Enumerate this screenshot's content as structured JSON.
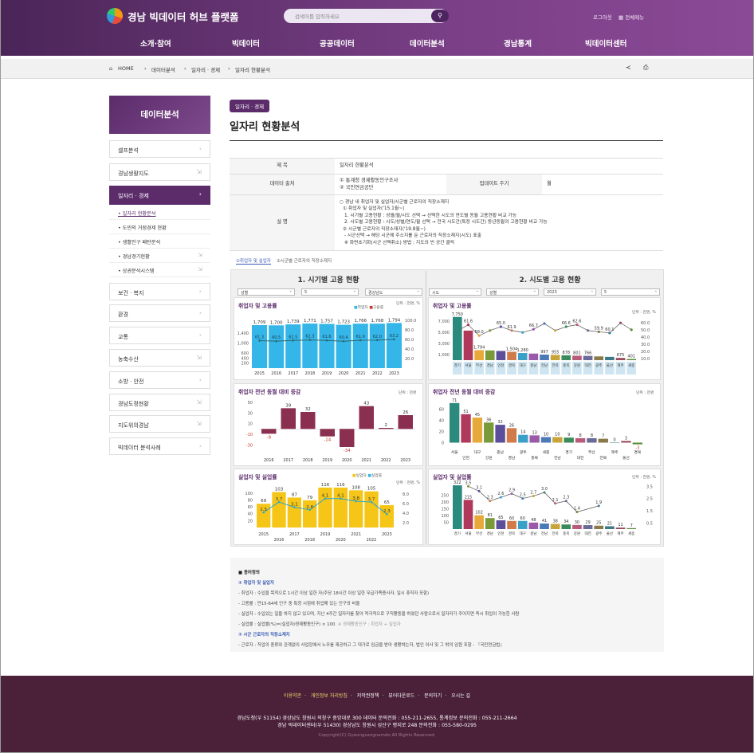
{
  "header": {
    "logo": "경남 빅데이터 허브 플랫폼",
    "search_placeholder": "검색어를 입력하세요",
    "login": "로그아웃",
    "all_menu": "전체메뉴"
  },
  "nav": [
    "소개·참여",
    "빅데이터",
    "공공데이터",
    "데이터분석",
    "경남통계",
    "빅데이터센터"
  ],
  "breadcrumb": {
    "home": "HOME",
    "items": [
      "데이터분석",
      "일자리 · 경제",
      "일자리 현황분석"
    ]
  },
  "sidebar": {
    "title": "데이터분석",
    "items": [
      "셀프분석",
      "경남생활지도",
      "일자리 · 경제",
      "보건 · 복지",
      "환경",
      "교통",
      "농축수산",
      "소방 · 안전",
      "경남도정현황",
      "지도위의경남",
      "빅데이터 분석사례"
    ],
    "sub": [
      "일자리 현황분석",
      "도민의 거점경제 현황",
      "생활인구 패턴분석",
      "경남경기현황",
      "상권분석시스템"
    ]
  },
  "page": {
    "badge": "일자리 · 경제",
    "title": "일자리 현황분석"
  },
  "info": {
    "k_title": "제 목",
    "v_title": "일자리 현황분석",
    "k_source": "데이터 출처",
    "v_source1": "① 통계청 경제활동인구조사",
    "v_source2": "② 국민연금공단",
    "k_cycle": "업데이트 주기",
    "v_cycle": "월",
    "k_desc": "설 명",
    "desc": [
      "○ 경남 내 취업자 및 실업자/시군별 근로자의 직장소재지",
      "① 취업자 및 실업자('15.1월~)",
      "1. 시기별 고용현황 : 성별/월/시도 선택 → 선택한 시도의 연도별 동월 고용현황 비교 가능",
      "2. 시도별 고용현황 : 시도/성별/연도/월 선택 → 전국 시도간(특정 시도간) 동년동월의 고용현황 비교 가능",
      "② 시군별 근로자의 직장소재지('19.8월~)",
      "- 시군선택 → 해당 시군에 주소지를 둔 근로자의 직장소재지(시도) 표출",
      "※ 화면초기화(시군 선택취소) 방법 : 지도의 빈 공간 클릭"
    ]
  },
  "tabs": [
    "①취업자 및 실업자",
    "②시군별 근로자의 직장소재지"
  ],
  "panels": {
    "left_title": "1. 시기별 고용 현황",
    "right_title": "2. 시도별 고용 현황",
    "left_selects": [
      "성별",
      "5",
      "경상남도"
    ],
    "right_selects": [
      "시도",
      "성별",
      "2023",
      "5"
    ]
  },
  "cards": {
    "c1": "취업자 및 고용률",
    "c2": "취업자 및 고용률",
    "c3": "취업자 전년 동월 대비 증감",
    "c4": "취업자 전년 동월 대비 증감",
    "c5": "실업자 및 실업률",
    "c6": "실업자 및 실업률",
    "u1": "단위 : 천명, %",
    "u2": "단위 : 천명, %",
    "u3": "단위 : 천명",
    "u4": "단위 : 천명",
    "u5": "단위 : 천명, %",
    "u6": "단위 : 천명, %",
    "leg_emp": "취업자",
    "leg_rate": "고용률",
    "leg_unemp": "실업자",
    "leg_urate": "실업률"
  },
  "chart_data": [
    {
      "type": "bar",
      "title": "취업자 및 고용률",
      "categories": [
        "2015",
        "2016",
        "2017",
        "2018",
        "2019",
        "2020",
        "2021",
        "2022",
        "2023"
      ],
      "series": [
        {
          "name": "취업자",
          "values": [
            1709,
            1700,
            1739,
            1771,
            1757,
            1723,
            1766,
            1768,
            1794
          ]
        },
        {
          "name": "고용률",
          "values": [
            61.3,
            60.5,
            61.5,
            62.3,
            61.6,
            60.4,
            61.9,
            62.0,
            63.2
          ]
        }
      ],
      "yticks_left": [
        200,
        400,
        600,
        1000,
        1400
      ],
      "yticks_right": [
        "20.0",
        "40.0",
        "60.0",
        "80.0",
        "100.0"
      ]
    },
    {
      "type": "bar",
      "title": "취업자 및 고용률",
      "categories": [
        "경기",
        "서울",
        "부산",
        "경남",
        "인천",
        "경북",
        "대구",
        "충남",
        "전남",
        "전북",
        "충북",
        "강원",
        "대전",
        "광주",
        "울산",
        "제주",
        "세종"
      ],
      "series": [
        {
          "name": "취업자",
          "values": [
            7750,
            5300,
            1794,
            1750,
            1650,
            1504,
            1280,
            1180,
            997,
            955,
            878,
            801,
            766,
            675,
            590,
            401,
            211
          ]
        },
        {
          "name": "고용률",
          "values": [
            61.6,
            66.5,
            58.0,
            62.0,
            65.0,
            62.0,
            60.5,
            63.0,
            67.5,
            62.0,
            65.0,
            66.6,
            62.0,
            61.0,
            60.1,
            68.0,
            62.6
          ]
        }
      ],
      "data_labels": [
        "7,750",
        "61.6",
        "58.0",
        "65.0",
        "61.9",
        "66.7",
        "66.6",
        "62.6",
        "59.9",
        "60.1",
        "1,794",
        "1,504",
        "1,280",
        "997",
        "955",
        "878",
        "801",
        "766",
        "675",
        "401",
        "211"
      ],
      "yticks_left": [
        "1,000",
        "3,000",
        "5,000",
        "7,000"
      ],
      "yticks_right": [
        "10.0",
        "20.0",
        "30.0",
        "40.0",
        "50.0",
        "60.0"
      ]
    },
    {
      "type": "bar",
      "title": "취업자 전년 동월 대비 증감",
      "categories": [
        "2016",
        "2017",
        "2018",
        "2019",
        "2020",
        "2021",
        "2022",
        "2023"
      ],
      "values": [
        -9,
        39,
        32,
        -14,
        -34,
        43,
        2,
        26
      ],
      "yticks": [
        "-30",
        "-10",
        "10",
        "30",
        "50"
      ]
    },
    {
      "type": "bar",
      "title": "취업자 전년 동월 대비 증감",
      "categories": [
        "서울",
        "인천",
        "대구",
        "강원",
        "충남",
        "경남",
        "광주",
        "충북",
        "세종",
        "전남",
        "경기",
        "대전",
        "부산",
        "전북",
        "제주",
        "울산",
        "경북"
      ],
      "values": [
        71,
        51,
        45,
        36,
        32,
        26,
        14,
        13,
        10,
        10,
        9,
        8,
        8,
        7,
        0,
        3,
        -3
      ],
      "xlabels_top": [
        "서울",
        "대구",
        "충남",
        "광주",
        "세종",
        "경기",
        "부산",
        "제주",
        "경북"
      ],
      "xlabels_bottom": [
        "인천",
        "강원",
        "경남",
        "충북",
        "전남",
        "대전",
        "전북",
        "울산"
      ],
      "yticks": [
        "0",
        "20",
        "40",
        "60"
      ]
    },
    {
      "type": "bar",
      "title": "실업자 및 실업률",
      "categories": [
        "2015",
        "2016",
        "2017",
        "2018",
        "2019",
        "2020",
        "2021",
        "2022",
        "2023"
      ],
      "series": [
        {
          "name": "실업자",
          "values": [
            69,
            103,
            87,
            79,
            116,
            116,
            108,
            105,
            65
          ]
        },
        {
          "name": "실업률",
          "values": [
            2.5,
            3.7,
            3.1,
            2.8,
            4.1,
            4.1,
            3.8,
            3.7,
            2.3
          ]
        }
      ],
      "xlabels_top": [
        "2015",
        "2017",
        "2019",
        "2021",
        "2023"
      ],
      "xlabels_bottom": [
        "2016",
        "2018",
        "2020",
        "2022"
      ],
      "yticks_left": [
        "20",
        "40",
        "60",
        "80",
        "100"
      ],
      "yticks_right": [
        "2.0",
        "4.0",
        "6.0",
        "8.0"
      ]
    },
    {
      "type": "bar",
      "title": "실업자 및 실업률",
      "categories": [
        "경기",
        "서울",
        "부산",
        "경남",
        "인천",
        "경북",
        "대구",
        "충남",
        "전남",
        "전북",
        "충북",
        "강원",
        "대전",
        "광주",
        "울산",
        "제주",
        "세종"
      ],
      "series": [
        {
          "name": "실업자",
          "values": [
            322,
            215,
            102,
            81,
            65,
            60,
            60,
            48,
            41,
            38,
            34,
            30,
            29,
            25,
            21,
            11,
            7
          ]
        },
        {
          "name": "실업률",
          "values": [
            3.5,
            3.1,
            2.3,
            2.6,
            2.9,
            2.5,
            2.7,
            3.0,
            2.1,
            2.3,
            1.4,
            1.9
          ]
        }
      ],
      "yticks_left": [
        "50",
        "100",
        "150",
        "200",
        "250"
      ],
      "yticks_right": [
        "0.5",
        "1.5",
        "2.5",
        "3.5"
      ]
    }
  ],
  "terms": {
    "title": "■ 용어정의",
    "s1": "① 취업자 및 실업자",
    "l1": "- 취업자 : 수입을 목적으로 1시간 이상 일한 자(주당 18시간 이상 일한 무급가족종사자, 일시 휴직자 포함)",
    "l2": "- 고용률 : 만15-64세 인구 중 특정 시점에 취업해 있는 인구의 비율",
    "l3": "- 실업자 : 수입있는 일을 하지 않고 있으며, 지난 4주간 일자리를 찾아 적극적으로 구직활동을 하였던 사람으로서 일자리가 주어지면 즉시 취업이 가능한 사람",
    "l4": "- 실업률 : 실업률(%)=(실업자/경제활동인구) × 100",
    "l4b": "※ 경제활동인구 : 취업자 + 실업자",
    "s2": "② 시군 근로자의 직장소재지",
    "l5": "- 근로자 : 직업의 종류와 관계없이 사업장에서 노무를 제공하고 그 대가로 임금을 받아 생활하는자, 법인 이사 및 그 밖의 임원 포함 - 『국민연금법』"
  },
  "footer": {
    "links": [
      "이용약관",
      "개인정보 처리방침",
      "저작권정책",
      "뷰어다운로드",
      "문의하기",
      "오시는 길"
    ],
    "addr1": "경남도청(우 51154) 경상남도 창원시 의창구 중앙대로 300 데이터 문의전화 : 055-211-2655, 통계정보 문의전화 : 055-211-2664",
    "addr2": "경남 빅데이터센터(우 51430) 경상남도 창원시 성산구 평지로 248 문의전화 : 055-580-0295",
    "copy": "Copyright(C) Gyeongsangnamdo All Rights Reserved."
  }
}
